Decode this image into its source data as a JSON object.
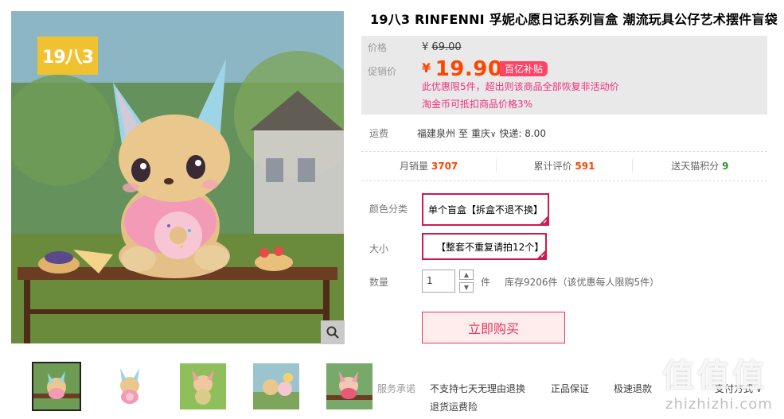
{
  "gallery": {
    "brand_badge": "19八3",
    "thumbnails": [
      {
        "name": "thumb-1",
        "active": true
      },
      {
        "name": "thumb-2",
        "active": false
      },
      {
        "name": "thumb-3",
        "active": false
      },
      {
        "name": "thumb-4",
        "active": false
      },
      {
        "name": "thumb-5",
        "active": false
      }
    ],
    "zoom_icon": "magnifier-icon"
  },
  "product": {
    "title": "19八3 RINFENNI 孚妮心愿日记系列盲盒 潮流玩具公仔艺术摆件盲袋"
  },
  "price": {
    "original_label": "价格",
    "currency": "¥",
    "original_value": "69.00",
    "promo_label": "促销价",
    "promo_value": "19.90",
    "subsidy_badge": "百亿补贴",
    "promo_note": "此优惠限5件，超出则该商品全部恢复非活动价",
    "coin_note": "淘金币可抵扣商品价格3%"
  },
  "shipping": {
    "label": "运费",
    "from": "福建泉州",
    "to_word": "至",
    "to": "重庆",
    "express": "快递: 8.00"
  },
  "stats": {
    "monthly_sales_label": "月销量",
    "monthly_sales": "3707",
    "reviews_label": "累计评价",
    "reviews": "591",
    "points_label": "送天猫积分",
    "points": "9"
  },
  "sku": {
    "color_label": "颜色分类",
    "color_option": "单个盲盒【拆盒不退不换】",
    "size_label": "大小",
    "size_option": "【整套不重复请拍12个】"
  },
  "quantity": {
    "label": "数量",
    "value": "1",
    "unit": "件",
    "stock": "库存9206件（该优惠每人限购5件）"
  },
  "buy_button": "立即购买",
  "service": {
    "label": "服务承诺",
    "items": [
      "不支持七天无理由退换",
      "正品保证",
      "极速退款",
      "支付方式"
    ],
    "item_extra": "退货运费险"
  },
  "watermark": {
    "glyphs": "值值值",
    "url": "zhizhizhi.com"
  },
  "colors": {
    "accent": "#ff4400",
    "sku_border": "#d0194d",
    "buy_button_text": "#e5395c",
    "promo_note": "#f2307a"
  }
}
